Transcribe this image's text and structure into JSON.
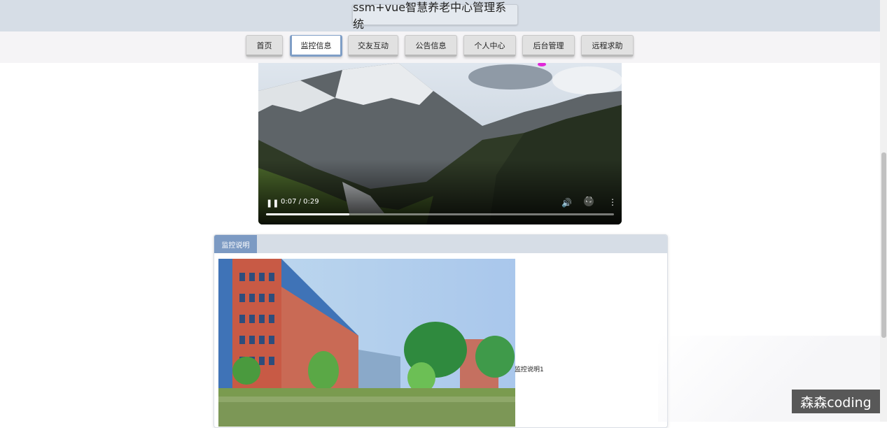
{
  "header": {
    "title": "ssm+vue智慧养老中心管理系统"
  },
  "nav": {
    "items": [
      {
        "label": "首页"
      },
      {
        "label": "监控信息"
      },
      {
        "label": "交友互动"
      },
      {
        "label": "公告信息"
      },
      {
        "label": "个人中心"
      },
      {
        "label": "后台管理"
      },
      {
        "label": "远程求助"
      }
    ],
    "active": "监控信息"
  },
  "video": {
    "time": "0:07 / 0:29",
    "progress_fraction": 0.24,
    "icons": [
      "pause-icon",
      "volume-icon",
      "fullscreen-icon",
      "more-options-icon"
    ]
  },
  "panel": {
    "tab_label": "监控说明",
    "description": "监控说明1"
  },
  "watermark": "森森coding",
  "colors": {
    "header_bg": "#d6dde6",
    "accent": "#7c9ac3"
  }
}
